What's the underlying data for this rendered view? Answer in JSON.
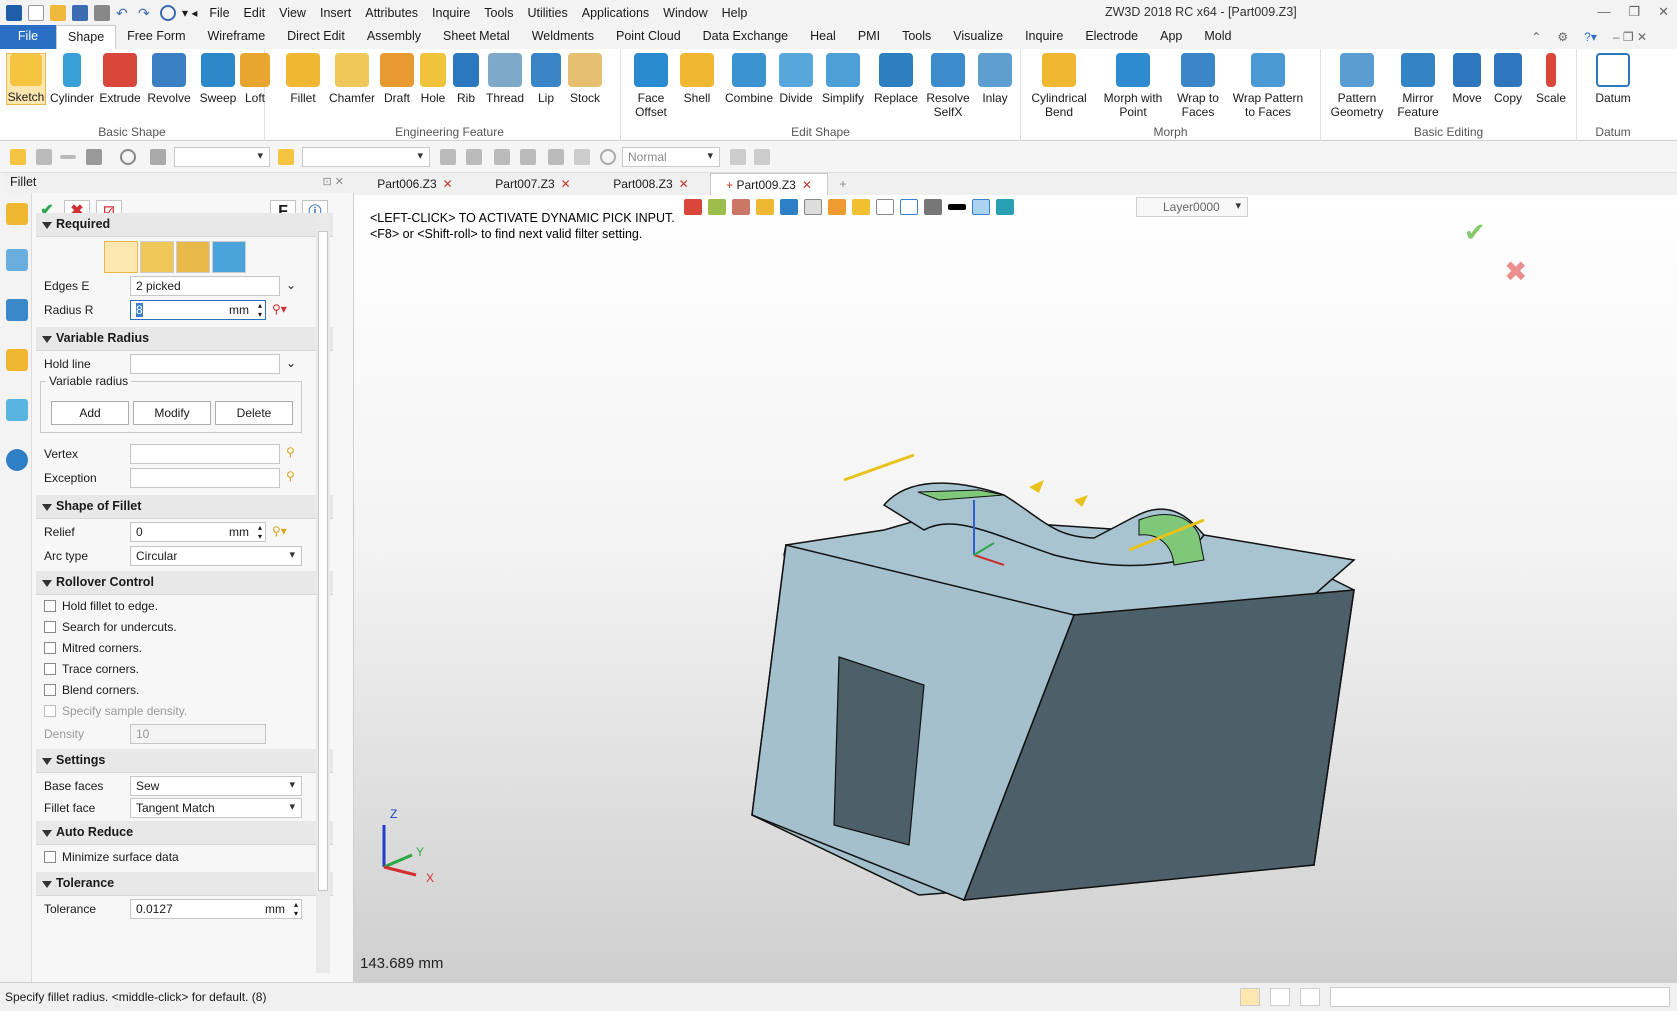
{
  "window": {
    "title": "ZW3D 2018 RC x64 - [Part009.Z3]"
  },
  "menu": [
    "File",
    "Edit",
    "View",
    "Insert",
    "Attributes",
    "Inquire",
    "Tools",
    "Utilities",
    "Applications",
    "Window",
    "Help"
  ],
  "ribbon_tabs": [
    "File",
    "Shape",
    "Free Form",
    "Wireframe",
    "Direct Edit",
    "Assembly",
    "Sheet Metal",
    "Weldments",
    "Point Cloud",
    "Data Exchange",
    "Heal",
    "PMI",
    "Tools",
    "Visualize",
    "Inquire",
    "Electrode",
    "App",
    "Mold"
  ],
  "active_ribbon_tab": "Shape",
  "ribbon_groups": [
    {
      "label": "Basic Shape",
      "buttons": [
        "Sketch",
        "Cylinder",
        "Extrude",
        "Revolve",
        "Sweep",
        "Loft"
      ]
    },
    {
      "label": "Engineering Feature",
      "buttons": [
        "Fillet",
        "Chamfer",
        "Draft",
        "Hole",
        "Rib",
        "Thread",
        "Lip",
        "Stock"
      ]
    },
    {
      "label": "Edit Shape",
      "buttons": [
        "Face Offset",
        "Shell",
        "Combine",
        "Divide",
        "Simplify",
        "Replace",
        "Resolve SelfX",
        "Inlay"
      ]
    },
    {
      "label": "Morph",
      "buttons": [
        "Cylindrical Bend",
        "Morph with Point",
        "Wrap to Faces",
        "Wrap Pattern to Faces"
      ]
    },
    {
      "label": "Basic Editing",
      "buttons": [
        "Pattern Geometry",
        "Mirror Feature",
        "Move",
        "Copy",
        "Scale"
      ]
    },
    {
      "label": "Datum",
      "buttons": [
        "Datum"
      ]
    }
  ],
  "toolbar": {
    "render_mode": "Normal"
  },
  "doc_tabs": [
    "Part006.Z3",
    "Part007.Z3",
    "Part008.Z3",
    "Part009.Z3"
  ],
  "active_doc": "Part009.Z3",
  "panel": {
    "title": "Fillet",
    "help_letter": "F",
    "required": {
      "header": "Required",
      "edges_label": "Edges E",
      "edges_value": "2 picked",
      "radius_label": "Radius R",
      "radius_value": "8",
      "radius_unit": "mm"
    },
    "variable_radius": {
      "header": "Variable Radius",
      "hold_line_label": "Hold line",
      "group_label": "Variable radius",
      "add": "Add",
      "modify": "Modify",
      "delete": "Delete",
      "vertex_label": "Vertex",
      "exception_label": "Exception"
    },
    "shape": {
      "header": "Shape of Fillet",
      "relief_label": "Relief",
      "relief_value": "0",
      "relief_unit": "mm",
      "arc_label": "Arc type",
      "arc_value": "Circular"
    },
    "rollover": {
      "header": "Rollover Control",
      "options": [
        "Hold fillet to edge.",
        "Search for undercuts.",
        "Mitred corners.",
        "Trace corners.",
        "Blend corners."
      ],
      "sample_density": "Specify sample density.",
      "density_label": "Density",
      "density_value": "10"
    },
    "settings": {
      "header": "Settings",
      "base_label": "Base faces",
      "base_value": "Sew",
      "fillet_face_label": "Fillet face",
      "fillet_face_value": "Tangent Match"
    },
    "auto_reduce": {
      "header": "Auto Reduce",
      "minimize": "Minimize surface data"
    },
    "tolerance": {
      "header": "Tolerance",
      "label": "Tolerance",
      "value": "0.0127",
      "unit": "mm"
    }
  },
  "viewport": {
    "hint_line1": "<LEFT-CLICK> TO ACTIVATE DYNAMIC PICK INPUT.",
    "hint_line2": "<F8> or <Shift-roll> to find next valid filter setting.",
    "distance": "143.689 mm",
    "layer": "Layer0000",
    "triad": {
      "z": "Z",
      "y": "Y",
      "x": "X"
    }
  },
  "status": {
    "text": "Specify fillet radius.  <middle-click> for default. (8)"
  },
  "colors": {
    "accent": "#2b6fc4",
    "model_face": "#a8c4d0",
    "model_dark": "#4d5f68",
    "fillet_green": "#7fc87a",
    "selection_yellow": "#e8c21a"
  }
}
